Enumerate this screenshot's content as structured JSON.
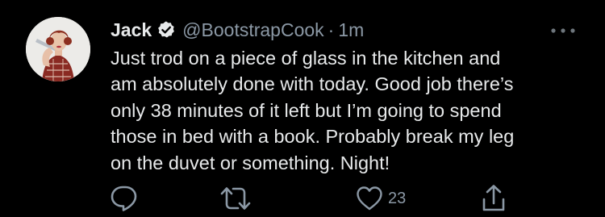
{
  "tweet": {
    "author_name": "Jack",
    "handle": "@BootstrapCook",
    "separator": "·",
    "time": "1m",
    "text": "Just trod on a piece of glass in the kitchen and\nam absolutely done with today. Good job there’s\nonly 38 minutes of it left but I’m going to spend\nthose in bed with a book. Probably break my leg\non the duvet or something. Night!",
    "likes": "23"
  },
  "icons": {
    "verified": "verified-badge-icon",
    "more": "more-options-icon",
    "reply": "reply-icon",
    "retweet": "retweet-icon",
    "like": "heart-icon",
    "share": "share-icon"
  },
  "colors": {
    "background": "#000000",
    "primary_text": "#e7e9ea",
    "secondary_text": "#8b98a5"
  }
}
